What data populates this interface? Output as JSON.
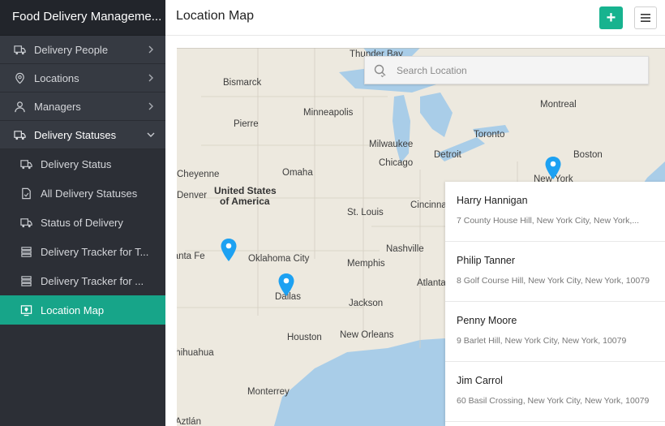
{
  "app": {
    "title": "Food Delivery Manageme..."
  },
  "sidebar": {
    "items": [
      {
        "label": "Delivery People",
        "icon": "truck-icon",
        "expanded": false
      },
      {
        "label": "Locations",
        "icon": "map-marker-icon",
        "expanded": false
      },
      {
        "label": "Managers",
        "icon": "user-icon",
        "expanded": false
      },
      {
        "label": "Delivery Statuses",
        "icon": "truck-icon",
        "expanded": true
      }
    ],
    "subitems": [
      {
        "label": "Delivery Status",
        "icon": "truck-icon"
      },
      {
        "label": "All Delivery Statuses",
        "icon": "document-icon"
      },
      {
        "label": "Status of Delivery",
        "icon": "truck-icon"
      },
      {
        "label": "Delivery Tracker for T...",
        "icon": "list-icon"
      },
      {
        "label": "Delivery Tracker for ...",
        "icon": "list-icon"
      },
      {
        "label": "Location Map",
        "icon": "map-board-icon",
        "active": true
      }
    ]
  },
  "header": {
    "title": "Location Map",
    "add_label": "+",
    "accent": "#17b38f"
  },
  "search": {
    "placeholder": "Search Location"
  },
  "map": {
    "labels": [
      "Thunder Bay",
      "Bismarck",
      "Minneapolis",
      "Pierre",
      "Montreal",
      "Milwaukee",
      "Toronto",
      "Detroit",
      "Boston",
      "Chicago",
      "Cheyenne",
      "Omaha",
      "United States",
      "of America",
      "Denver",
      "St. Louis",
      "Cincinna",
      "New York",
      "Oklahoma City",
      "Nashville",
      "Memphis",
      "Santa Fe",
      "Atlanta",
      "Dallas",
      "Jackson",
      "Houston",
      "New Orleans",
      "Chihuahua",
      "Monterrey",
      "Aztlán"
    ]
  },
  "locations": [
    {
      "name": "Harry Hannigan",
      "address": "7 County House Hill, New York City, New York,..."
    },
    {
      "name": "Philip Tanner",
      "address": "8 Golf Course Hill, New York City, New York, 10079"
    },
    {
      "name": "Penny Moore",
      "address": "9 Barlet Hill, New York City, New York, 10079"
    },
    {
      "name": "Jim Carrol",
      "address": "60 Basil Crossing, New York City, New York, 10079"
    }
  ],
  "colors": {
    "sidebar_bg": "#2c2f36",
    "active_item": "#17a589",
    "pin": "#1da1f2",
    "water": "#a9cde8",
    "land": "#ede9df"
  }
}
